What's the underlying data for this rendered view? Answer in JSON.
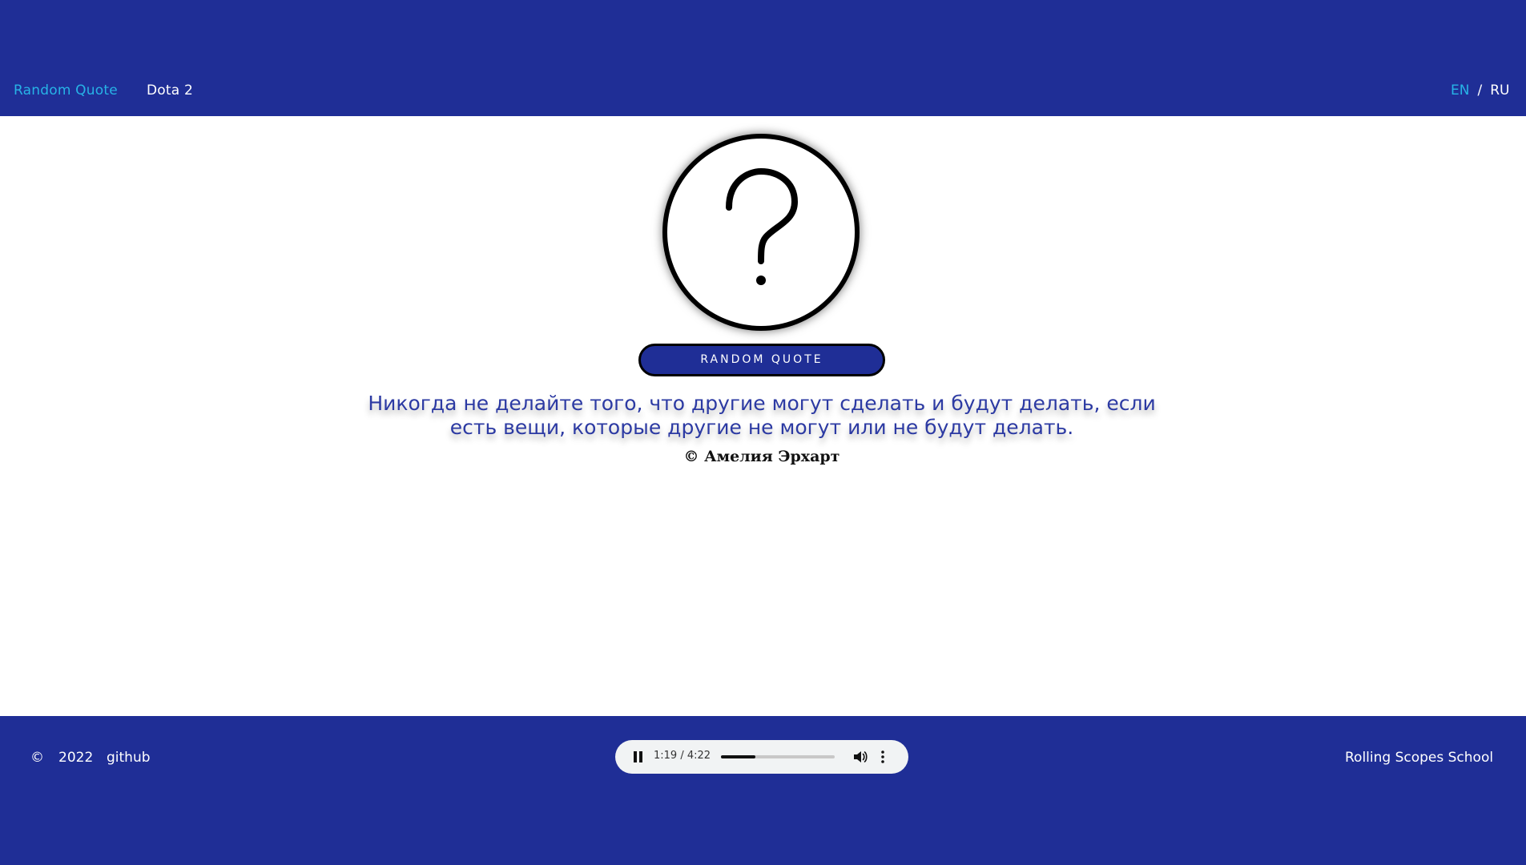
{
  "header": {
    "nav": [
      {
        "label": "Random Quote",
        "active": true
      },
      {
        "label": "Dota 2",
        "active": false
      }
    ],
    "lang": {
      "options": [
        "EN",
        "RU"
      ],
      "active": "EN",
      "separator": "/"
    }
  },
  "main": {
    "image_icon": "question-mark-icon",
    "button_label": "RANDOM QUOTE",
    "quote_line1": "Никогда не делайте того, что другие могут сделать и будут делать, если",
    "quote_line2": "есть вещи, которые другие не могут или не будут делать.",
    "author": "© Амелия Эрхарт"
  },
  "footer": {
    "copyright_icon": "©",
    "year": "2022",
    "github": "github",
    "school": "Rolling Scopes School",
    "audio": {
      "time": "1:19 / 4:22",
      "progress": 0.3
    }
  },
  "colors": {
    "brand": "#1f2e96",
    "accent": "#27b3e6",
    "quote": "#2c3aa3"
  }
}
